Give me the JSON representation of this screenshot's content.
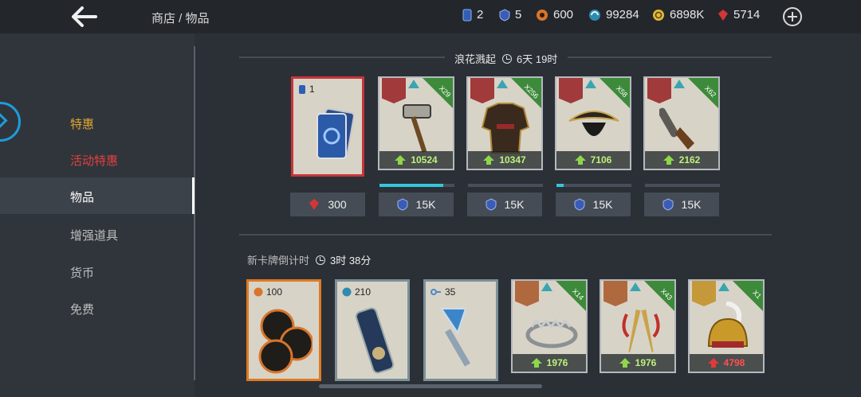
{
  "header": {
    "breadcrumb": "商店 / 物品"
  },
  "resources": [
    {
      "icon": "blue-card-icon",
      "value": "2"
    },
    {
      "icon": "blue-shield-icon",
      "value": "5"
    },
    {
      "icon": "orange-token-icon",
      "value": "600"
    },
    {
      "icon": "cyan-swirl-icon",
      "value": "99284"
    },
    {
      "icon": "gold-coin-icon",
      "value": "6898K"
    },
    {
      "icon": "ruby-icon",
      "value": "5714"
    }
  ],
  "sidebar": {
    "items": [
      {
        "label": "特惠",
        "color": "#e0a531"
      },
      {
        "label": "活动特惠",
        "color": "#e0413f"
      },
      {
        "label": "物品",
        "color": "#ffffff"
      },
      {
        "label": "增强道具",
        "color": "#bdbdbd"
      },
      {
        "label": "货币",
        "color": "#bdbdbd"
      },
      {
        "label": "免费",
        "color": "#bdbdbd"
      }
    ]
  },
  "section1": {
    "title": "浪花溅起",
    "timer": "6天 19时",
    "cards": [
      {
        "count": "1"
      },
      {
        "multiplier": "X29",
        "price": "10524",
        "progress": 0.85
      },
      {
        "multiplier": "X256",
        "price": "10347",
        "progress": 0.0
      },
      {
        "multiplier": "X58",
        "price": "7106",
        "progress": 0.1
      },
      {
        "multiplier": "X62",
        "price": "2162",
        "progress": 0.0
      }
    ],
    "buttons": [
      "300",
      "15K",
      "15K",
      "15K",
      "15K"
    ]
  },
  "section2": {
    "title": "新卡牌倒计时",
    "timer": "3时 38分",
    "cards": [
      {
        "count": "100"
      },
      {
        "count": "210"
      },
      {
        "count": "35"
      },
      {
        "multiplier": "X14",
        "price": "1976"
      },
      {
        "multiplier": "X43",
        "price": "1976"
      },
      {
        "multiplier": "X1",
        "price": "4798"
      }
    ]
  }
}
